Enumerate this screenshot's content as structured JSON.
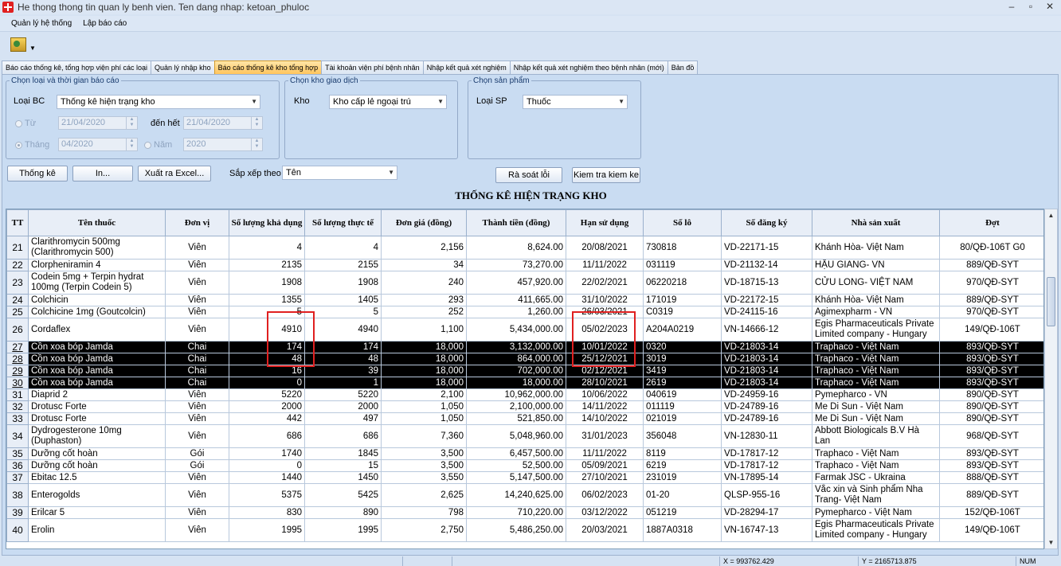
{
  "window": {
    "title": "He thong thong tin quan ly benh vien. Ten dang nhap: ketoan_phuloc",
    "controls": [
      "–",
      "▫",
      "✕"
    ]
  },
  "menu": [
    "Quản lý hệ thống",
    "Lập báo cáo"
  ],
  "toolbar": {
    "icon": "report-tool-icon"
  },
  "tabs": [
    "Báo cáo thống kê, tổng hợp viện phí các loại",
    "Quản lý nhập kho",
    "Báo cáo thống kê kho tổng hợp",
    "Tài khoản viện phí bệnh nhân",
    "Nhập kết quả xét nghiệm",
    "Nhập kết quả xét nghiệm theo bệnh nhân (mới)",
    "Bản đồ"
  ],
  "filters": {
    "report_group_legend": "Chọn loại và thời gian báo cáo",
    "report_type_label": "Loại BC",
    "report_type_value": "Thống kê hiện trạng kho",
    "from_label": "Từ",
    "from_value": "21/04/2020",
    "to_label": "đến hết",
    "to_value": "21/04/2020",
    "month_label": "Tháng",
    "month_value": "04/2020",
    "year_label": "Năm",
    "year_value": "2020",
    "warehouse_legend": "Chọn kho giao dịch",
    "warehouse_label": "Kho",
    "warehouse_value": "Kho cấp lẻ ngoại trú",
    "product_legend": "Chọn sản phẩm",
    "product_label": "Loại SP",
    "product_value": "Thuốc"
  },
  "actions": {
    "stats": "Thống kê",
    "print": "In...",
    "export": "Xuất ra Excel...",
    "sort_label": "Sắp xếp theo",
    "sort_value": "Tên",
    "review": "Rà soát lỗi",
    "check": "Kiem tra kiem ke"
  },
  "report_title": "THỐNG KÊ HIỆN TRẠNG KHO",
  "table": {
    "headers": [
      "TT",
      "Tên thuốc",
      "Đơn vị",
      "Số lượng khả dụng",
      "Số lượng thực tế",
      "Đơn giá (đồng)",
      "Thành tiền (đồng)",
      "Hạn sử dụng",
      "Số lô",
      "Số đăng ký",
      "Nhà sản xuất",
      "Đợt"
    ],
    "rows": [
      [
        "21",
        "Clarithromycin 500mg (Clarithromycin 500)",
        "Viên",
        "4",
        "4",
        "2,156",
        "8,624.00",
        "20/08/2021",
        "730818",
        "VD-22171-15",
        "Khánh Hòa- Việt Nam",
        "80/QĐ-106T G0"
      ],
      [
        "22",
        "Clorpheniramin 4",
        "Viên",
        "2135",
        "2155",
        "34",
        "73,270.00",
        "11/11/2022",
        "031119",
        "VD-21132-14",
        "HẬU GIANG- VN",
        "889/QĐ-SYT"
      ],
      [
        "23",
        "Codein 5mg + Terpin hydrat 100mg (Terpin Codein 5)",
        "Viên",
        "1908",
        "1908",
        "240",
        "457,920.00",
        "22/02/2021",
        "06220218",
        "VD-18715-13",
        "CỬU LONG- VIỆT NAM",
        "970/QĐ-SYT"
      ],
      [
        "24",
        "Colchicin",
        "Viên",
        "1355",
        "1405",
        "293",
        "411,665.00",
        "31/10/2022",
        "171019",
        "VD-22172-15",
        "Khánh Hòa- Việt Nam",
        "889/QĐ-SYT"
      ],
      [
        "25",
        "Colchicine 1mg (Goutcolcin)",
        "Viên",
        "5",
        "5",
        "252",
        "1,260.00",
        "26/03/2021",
        "C0319",
        "VD-24115-16",
        "Agimexpharm - VN",
        "970/QĐ-SYT"
      ],
      [
        "26",
        "Cordaflex",
        "Viên",
        "4910",
        "4940",
        "1,100",
        "5,434,000.00",
        "05/02/2023",
        "A204A0219",
        "VN-14666-12",
        "Egis Pharmaceuticals Private Limited company - Hungary",
        "149/QĐ-106T"
      ],
      [
        "27",
        "Cồn xoa bóp Jamda",
        "Chai",
        "174",
        "174",
        "18,000",
        "3,132,000.00",
        "10/01/2022",
        "0320",
        "VD-21803-14",
        "Traphaco - Việt Nam",
        "893/QĐ-SYT"
      ],
      [
        "28",
        "Cồn xoa bóp Jamda",
        "Chai",
        "48",
        "48",
        "18,000",
        "864,000.00",
        "25/12/2021",
        "3019",
        "VD-21803-14",
        "Traphaco - Việt Nam",
        "893/QĐ-SYT"
      ],
      [
        "29",
        "Cồn xoa bóp Jamda",
        "Chai",
        "16",
        "39",
        "18,000",
        "702,000.00",
        "02/12/2021",
        "3419",
        "VD-21803-14",
        "Traphaco - Việt Nam",
        "893/QĐ-SYT"
      ],
      [
        "30",
        "Cồn xoa bóp Jamda",
        "Chai",
        "0",
        "1",
        "18,000",
        "18,000.00",
        "28/10/2021",
        "2619",
        "VD-21803-14",
        "Traphaco - Việt Nam",
        "893/QĐ-SYT"
      ],
      [
        "31",
        "Diaprid 2",
        "Viên",
        "5220",
        "5220",
        "2,100",
        "10,962,000.00",
        "10/06/2022",
        "040619",
        "VD-24959-16",
        "Pymepharco - VN",
        "890/QĐ-SYT"
      ],
      [
        "32",
        "Drotusc Forte",
        "Viên",
        "2000",
        "2000",
        "1,050",
        "2,100,000.00",
        "14/11/2022",
        "011119",
        "VD-24789-16",
        "Me Di Sun - Việt Nam",
        "890/QĐ-SYT"
      ],
      [
        "33",
        "Drotusc Forte",
        "Viên",
        "442",
        "497",
        "1,050",
        "521,850.00",
        "14/10/2022",
        "021019",
        "VD-24789-16",
        "Me Di Sun - Việt Nam",
        "890/QĐ-SYT"
      ],
      [
        "34",
        "Dydrogesterone 10mg (Duphaston)",
        "Viên",
        "686",
        "686",
        "7,360",
        "5,048,960.00",
        "31/01/2023",
        "356048",
        "VN-12830-11",
        "Abbott Biologicals B.V Hà Lan",
        "968/QĐ-SYT"
      ],
      [
        "35",
        "Dưỡng cốt hoàn",
        "Gói",
        "1740",
        "1845",
        "3,500",
        "6,457,500.00",
        "11/11/2022",
        "8119",
        "VD-17817-12",
        "Traphaco - Việt Nam",
        "893/QĐ-SYT"
      ],
      [
        "36",
        "Dưỡng cốt hoàn",
        "Gói",
        "0",
        "15",
        "3,500",
        "52,500.00",
        "05/09/2021",
        "6219",
        "VD-17817-12",
        "Traphaco - Việt Nam",
        "893/QĐ-SYT"
      ],
      [
        "37",
        "Ebitac 12.5",
        "Viên",
        "1440",
        "1450",
        "3,550",
        "5,147,500.00",
        "27/10/2021",
        "231019",
        "VN-17895-14",
        "Farmak JSC - Ukraina",
        "888/QĐ-SYT"
      ],
      [
        "38",
        "Enterogolds",
        "Viên",
        "5375",
        "5425",
        "2,625",
        "14,240,625.00",
        "06/02/2023",
        "01-20",
        "QLSP-955-16",
        "Vắc xin và Sinh phẩm Nha Trang- Việt Nam",
        "889/QĐ-SYT"
      ],
      [
        "39",
        "Erilcar 5",
        "Viên",
        "830",
        "890",
        "798",
        "710,220.00",
        "03/12/2022",
        "051219",
        "VD-28294-17",
        "Pymepharco - Việt Nam",
        "152/QĐ-106T"
      ],
      [
        "40",
        "Erolin",
        "Viên",
        "1995",
        "1995",
        "2,750",
        "5,486,250.00",
        "20/03/2021",
        "1887A0318",
        "VN-16747-13",
        "Egis Pharmaceuticals Private Limited company - Hungary",
        "149/QĐ-106T"
      ]
    ],
    "tall_rows": [
      0,
      2,
      5,
      13,
      17,
      19
    ],
    "highlighted_rows": [
      6,
      7,
      8,
      9
    ]
  },
  "status": {
    "x": "X = 993762.429",
    "y": "Y = 2165713.875",
    "num": "NUM"
  },
  "colors": {
    "highlight_row": "#000000",
    "active_tab": "#ffc55d",
    "annotation_box": "#e02020"
  }
}
